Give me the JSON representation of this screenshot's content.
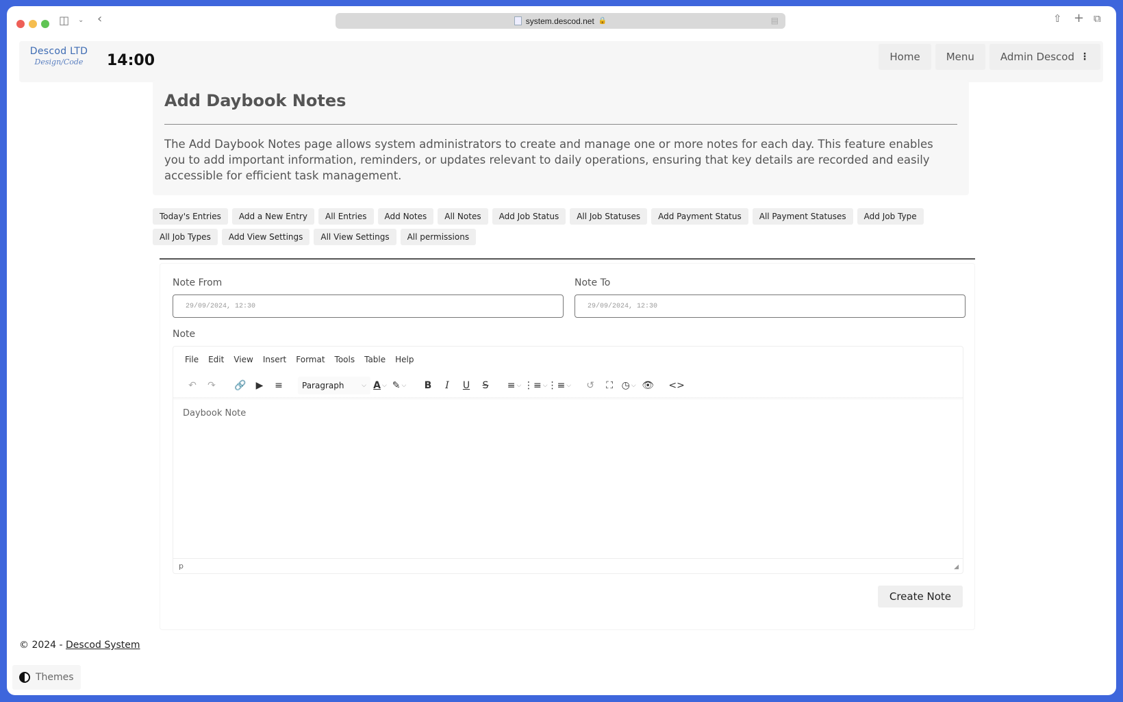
{
  "browser": {
    "url": "system.descod.net",
    "icons": [
      "sidebar-icon",
      "chevron-down-icon",
      "back-icon",
      "share-icon",
      "new-tab-icon",
      "tabs-overview-icon"
    ]
  },
  "header": {
    "logo_main": "Descod LTD",
    "logo_sub": "Design/Code",
    "clock": "14:00",
    "nav": [
      {
        "label": "Home"
      },
      {
        "label": "Menu"
      },
      {
        "label": "Admin Descod"
      }
    ]
  },
  "hero": {
    "title": "Add Daybook Notes",
    "description": "The Add Daybook Notes page allows system administrators to create and manage one or more notes for each day. This feature enables you to add important information, reminders, or updates relevant to daily operations, ensuring that key details are recorded and easily accessible for efficient task management."
  },
  "quick_links": [
    "Today's Entries",
    "Add a New Entry",
    "All Entries",
    "Add Notes",
    "All Notes",
    "Add Job Status",
    "All Job Statuses",
    "Add Payment Status",
    "All Payment Statuses",
    "Add Job Type",
    "All Job Types",
    "Add View Settings",
    "All View Settings",
    "All permissions"
  ],
  "form": {
    "note_from_label": "Note From",
    "note_from_value": "29/09/2024, 12:30",
    "note_to_label": "Note To",
    "note_to_value": "29/09/2024, 12:30",
    "note_label": "Note",
    "editor": {
      "menu": [
        "File",
        "Edit",
        "View",
        "Insert",
        "Format",
        "Tools",
        "Table",
        "Help"
      ],
      "block_format": "Paragraph",
      "placeholder": "Daybook Note",
      "status_path": "p"
    },
    "submit_label": "Create Note"
  },
  "footer": {
    "copyright": "© 2024 - ",
    "link_text": "Descod System",
    "themes_label": "Themes"
  }
}
